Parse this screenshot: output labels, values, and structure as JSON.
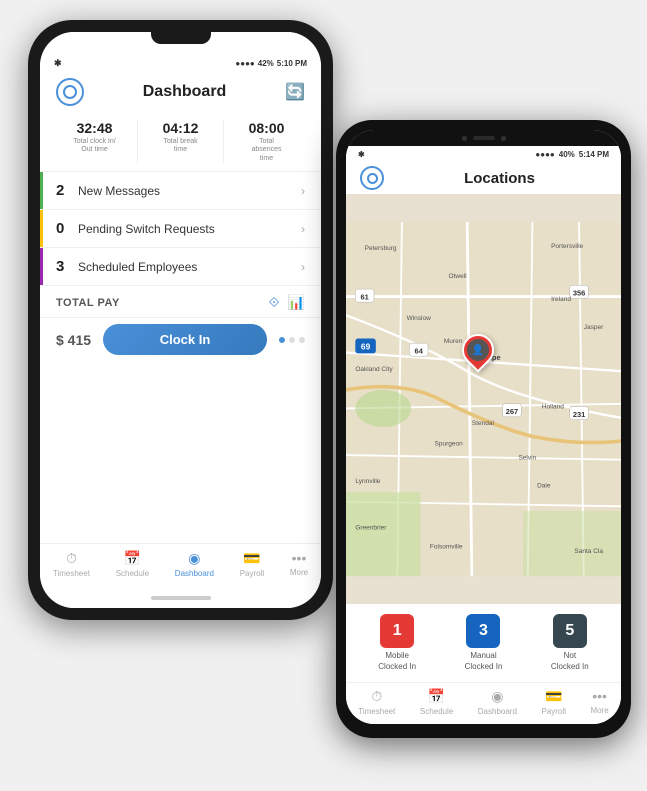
{
  "phone1": {
    "status_bar": {
      "bluetooth": "✱",
      "battery_pct": "42%",
      "time": "5:10 PM",
      "signal": "●●●●"
    },
    "header": {
      "title": "Dashboard",
      "logo_alt": "app-logo",
      "refresh_alt": "refresh"
    },
    "stats": [
      {
        "value": "32:48",
        "label": "Total clock In/\nOut time"
      },
      {
        "value": "04:12",
        "label": "Total break\ntime"
      },
      {
        "value": "08:00",
        "label": "Total\nabsences\ntime"
      }
    ],
    "menu_items": [
      {
        "badge": "2",
        "label": "New Messages",
        "accent": "#4caf50"
      },
      {
        "badge": "0",
        "label": "Pending Switch Requests",
        "accent": "#ffc107"
      },
      {
        "badge": "3",
        "label": "Scheduled Employees",
        "accent": "#9c27b0"
      }
    ],
    "total_pay": {
      "label": "TOTAL PAY"
    },
    "clock_in": {
      "amount": "$ 415",
      "button_label": "Clock In"
    },
    "nav": [
      {
        "icon": "⏱",
        "label": "Timesheet",
        "active": false
      },
      {
        "icon": "📅",
        "label": "Schedule",
        "active": false
      },
      {
        "icon": "⊙",
        "label": "Dashboard",
        "active": true
      },
      {
        "icon": "💳",
        "label": "Payroll",
        "active": false
      },
      {
        "icon": "···",
        "label": "More",
        "active": false
      }
    ]
  },
  "phone2": {
    "status_bar": {
      "bluetooth": "✱",
      "battery_pct": "40%",
      "time": "5:14 PM",
      "signal": "●●●●"
    },
    "header": {
      "title": "Locations"
    },
    "location_cards": [
      {
        "count": "1",
        "label": "Mobile\nClocked In",
        "color_class": "badge-red"
      },
      {
        "count": "3",
        "label": "Manual\nClocked In",
        "color_class": "badge-blue"
      },
      {
        "count": "5",
        "label": "Not\nClocked In",
        "color_class": "badge-dark"
      }
    ],
    "map_places": [
      "Petersburg",
      "Portersville",
      "Otwell",
      "Ireland",
      "Jasper",
      "Winslow",
      "Velpe",
      "Muren",
      "Oakland City",
      "Stendal",
      "Holland",
      "Spurgeon",
      "Selvin",
      "Dale",
      "Lynnville",
      "Greenbrier",
      "Folsomville",
      "Santa Cla"
    ],
    "nav": [
      {
        "icon": "⏱",
        "label": "Timesheet",
        "active": false
      },
      {
        "icon": "📅",
        "label": "Schedule",
        "active": false
      },
      {
        "icon": "⊙",
        "label": "Dashboard",
        "active": false
      },
      {
        "icon": "💳",
        "label": "Payroll",
        "active": false
      },
      {
        "icon": "···",
        "label": "More",
        "active": false
      }
    ]
  }
}
